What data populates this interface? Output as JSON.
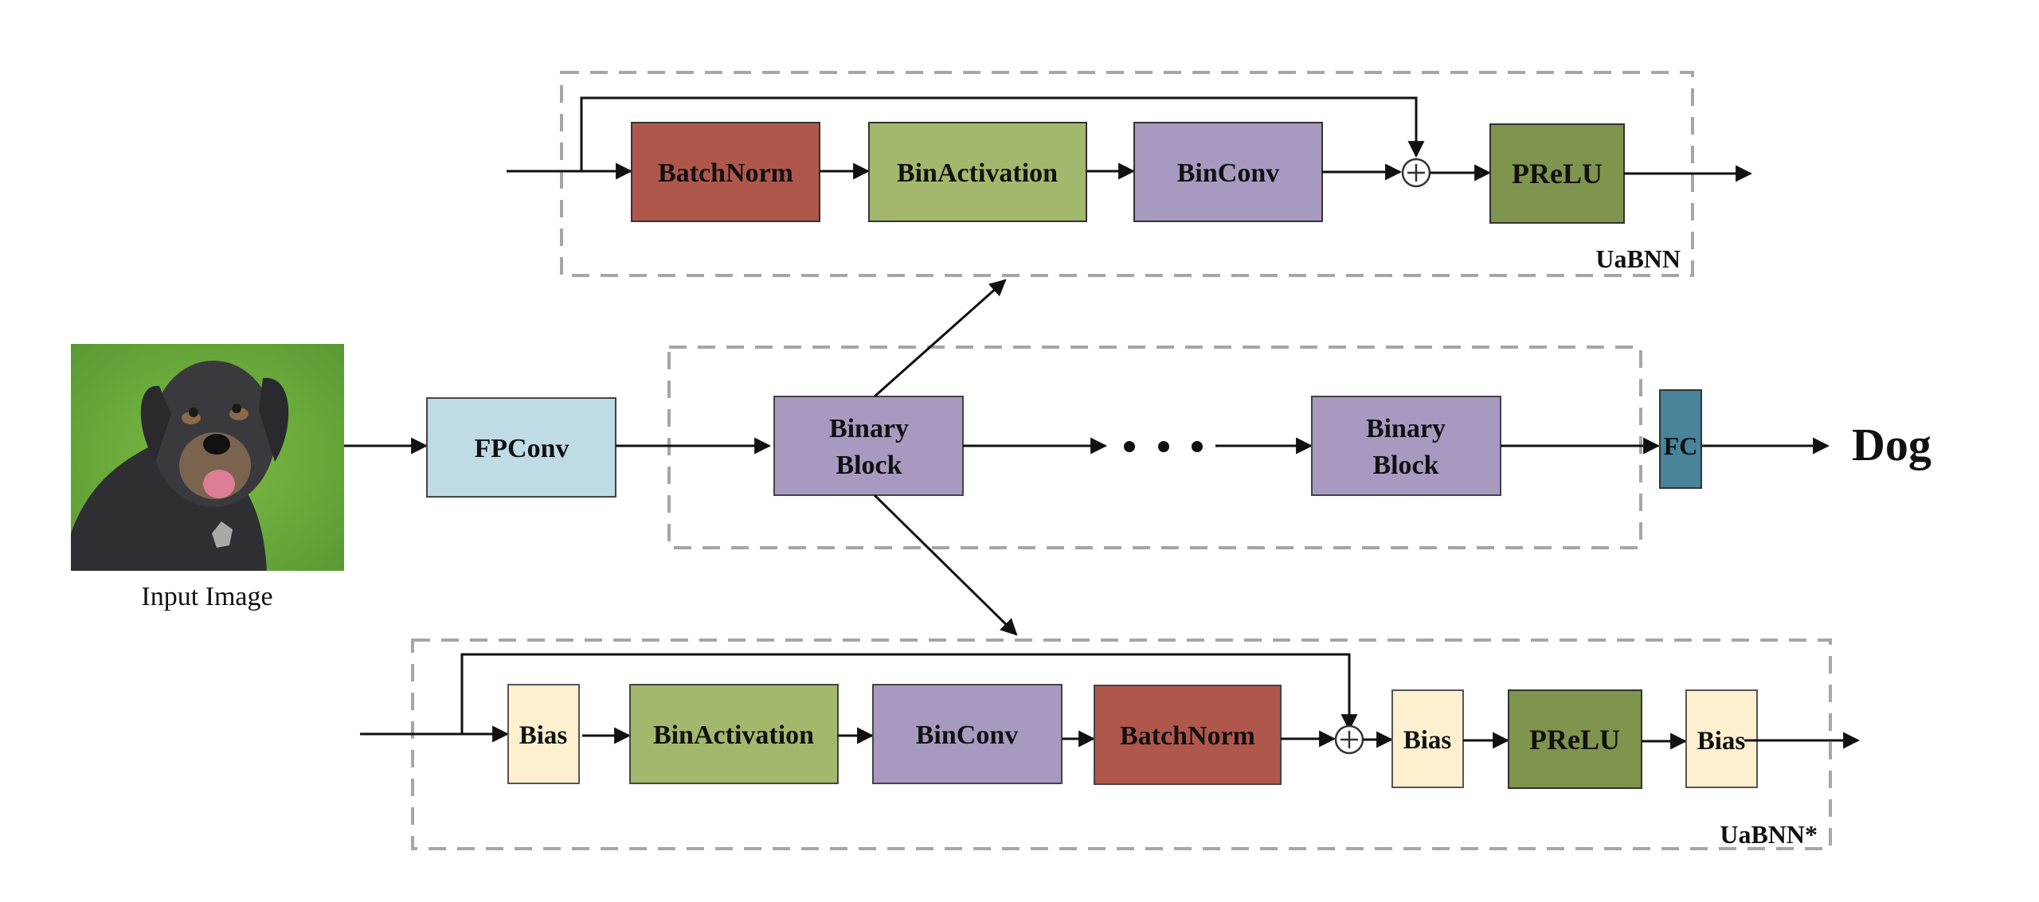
{
  "colors": {
    "batchnorm": "#b0574c",
    "binactivation": "#a3b86c",
    "binconv": "#a799bf",
    "prelu": "#7f944d",
    "fpconv": "#bedbe6",
    "binary_block": "#a799bf",
    "fc": "#48849a",
    "bias": "#fcf0cf",
    "dashed_border": "#a6a6a6",
    "line": "#111111",
    "grass": "#6aa83a"
  },
  "main": {
    "input_label": "Input Image",
    "fpconv": "FPConv",
    "binary_block_1": [
      "Binary",
      "Block"
    ],
    "ellipsis": "• • •",
    "binary_block_2": [
      "Binary",
      "Block"
    ],
    "fc": "FC",
    "output": "Dog"
  },
  "top_block": {
    "label": "UaBNN",
    "layers": [
      "BatchNorm",
      "BinActivation",
      "BinConv",
      "PReLU"
    ],
    "add_symbol": "+"
  },
  "bottom_block": {
    "label": "UaBNN*",
    "layers": [
      "Bias",
      "BinActivation",
      "BinConv",
      "BatchNorm",
      "Bias",
      "PReLU",
      "Bias"
    ],
    "add_symbol": "+"
  }
}
